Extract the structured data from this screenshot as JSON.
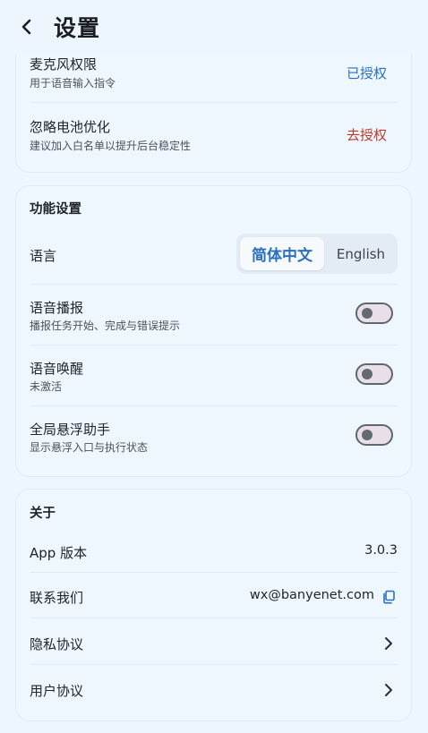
{
  "header": {
    "title": "设置"
  },
  "permissions": {
    "mic": {
      "title": "麦克风权限",
      "subtitle": "用于语音输入指令",
      "status": "已授权",
      "status_color": "#2b6fbf"
    },
    "battery": {
      "title": "忽略电池优化",
      "subtitle": "建议加入白名单以提升后台稳定性",
      "action": "去授权",
      "action_color": "#c0392b"
    }
  },
  "function_settings": {
    "section_title": "功能设置",
    "language": {
      "label": "语言",
      "options": [
        "简体中文",
        "English"
      ],
      "selected": "简体中文"
    },
    "voice_broadcast": {
      "title": "语音播报",
      "subtitle": "播报任务开始、完成与错误提示",
      "enabled": false
    },
    "voice_wakeup": {
      "title": "语音唤醒",
      "subtitle": "未激活",
      "enabled": false
    },
    "floating_assistant": {
      "title": "全局悬浮助手",
      "subtitle": "显示悬浮入口与执行状态",
      "enabled": false
    }
  },
  "about": {
    "section_title": "关于",
    "version": {
      "label": "App 版本",
      "value": "3.0.3"
    },
    "contact": {
      "label": "联系我们",
      "value": "wx@banyenet.com"
    },
    "privacy": {
      "label": "隐私协议"
    },
    "user_agreement": {
      "label": "用户协议"
    }
  },
  "icons": {
    "back": "chevron-left-icon",
    "copy": "copy-icon",
    "chevron": "chevron-right-icon"
  }
}
